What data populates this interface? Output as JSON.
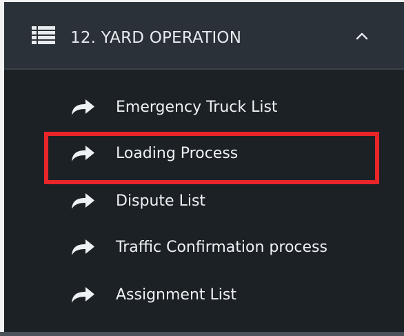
{
  "colors": {
    "menu_background": "#1c2126",
    "header_background": "#2b3138",
    "text": "#eef1f4",
    "highlight_border": "#e8262a"
  },
  "header": {
    "icon": "list-icon",
    "title": "12. YARD OPERATION",
    "toggle_icon": "chevron-up-icon",
    "expanded": true
  },
  "items": [
    {
      "label": "Emergency Truck List",
      "icon": "share-arrow-icon"
    },
    {
      "label": "Loading Process",
      "icon": "share-arrow-icon",
      "highlighted": true
    },
    {
      "label": "Dispute List",
      "icon": "share-arrow-icon"
    },
    {
      "label": "Traffic Confirmation process",
      "icon": "share-arrow-icon"
    },
    {
      "label": "Assignment List",
      "icon": "share-arrow-icon"
    }
  ]
}
